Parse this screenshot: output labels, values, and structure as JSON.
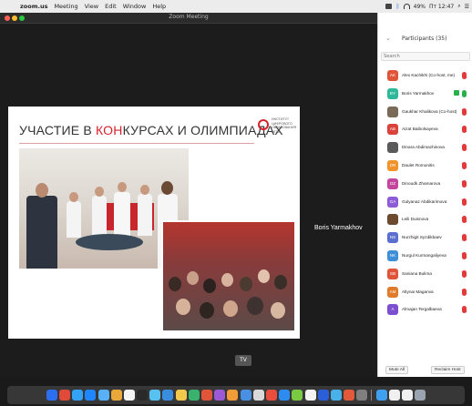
{
  "menubar": {
    "app_name": "zoom.us",
    "items": [
      "Meeting",
      "View",
      "Edit",
      "Window",
      "Help"
    ],
    "battery": "49%",
    "clock": "Пт 12:47"
  },
  "window": {
    "title": "Zoom Meeting"
  },
  "slide": {
    "title_prefix": "УЧАСТИЕ В ",
    "title_accent": "КОН",
    "title_rest": "КУРСАХ И ОЛИМПИАДАХ",
    "logo_text": "ИНСТИТУТ\nЦИФРОВОГО\nОБРАЗОВАНИЯ\nМГПУ"
  },
  "speaker": {
    "name": "Boris Yarmakhov"
  },
  "tv_badge": "TV",
  "participants_panel": {
    "title": "Participants (35)",
    "search_placeholder": "Search",
    "participants": [
      {
        "initials": "AK",
        "name": "Alex Kachikhi (Co-host, me)",
        "color": "#e0553a",
        "mic": "muted",
        "video": false
      },
      {
        "initials": "BY",
        "name": "Boris Yarmakhov",
        "color": "#2fb89a",
        "mic": "on",
        "video": true
      },
      {
        "initials": "",
        "name": "Gaukhar Khalikova (Co-host)",
        "color": "#7a6a58",
        "mic": "muted",
        "video": false
      },
      {
        "initials": "AB",
        "name": "Aizat Baibolsayeva",
        "color": "#d9433b",
        "mic": "muted",
        "video": false
      },
      {
        "initials": "",
        "name": "Dinara Abdimazhinova",
        "color": "#5a5a5a",
        "mic": "muted",
        "video": false
      },
      {
        "initials": "DR",
        "name": "Daulet Romonitis",
        "color": "#f0932b",
        "mic": "muted",
        "video": false
      },
      {
        "initials": "DZ",
        "name": "Dinoudk Zhamarova",
        "color": "#c4459e",
        "mic": "muted",
        "video": false
      },
      {
        "initials": "GA",
        "name": "Gulyanaz Abdikarimova",
        "color": "#8e5bd6",
        "mic": "muted",
        "video": false
      },
      {
        "initials": "",
        "name": "Leili Duisnova",
        "color": "#6b4a2e",
        "mic": "muted",
        "video": false
      },
      {
        "initials": "NS",
        "name": "Nurzhigit Syzdikbaev",
        "color": "#5a6fcf",
        "mic": "muted",
        "video": false
      },
      {
        "initials": "NK",
        "name": "Nurgul Kurmangaliyeva",
        "color": "#3f8fd8",
        "mic": "muted",
        "video": false
      },
      {
        "initials": "SB",
        "name": "Saniana Bulima",
        "color": "#e0553a",
        "mic": "muted",
        "video": false
      },
      {
        "initials": "AM",
        "name": "Altynai Maganva",
        "color": "#e07b2b",
        "mic": "muted",
        "video": false
      },
      {
        "initials": "A",
        "name": "Almajan Tergalbaeva",
        "color": "#7b4fd0",
        "mic": "muted",
        "video": false
      }
    ],
    "mute_all_label": "Mute All",
    "reclaim_host_label": "Reclaim Host"
  },
  "dock": {
    "icon_colors": [
      "#2b6ef2",
      "#e04a3a",
      "#34a2f5",
      "#1f86ff",
      "#5ab0f7",
      "#e8a83a",
      "#f4f4f4",
      "#2a2a2a",
      "#58c1f2",
      "#3a8dde",
      "#f2c94c",
      "#38b26d",
      "#e0553a",
      "#9b59d6",
      "#f29b38",
      "#4a90e2",
      "#d9d9d9",
      "#e84d3d",
      "#2d8cf0",
      "#7ac943",
      "#f2f2f2",
      "#2b5fd9",
      "#4ab0e8",
      "#e25a3a",
      "#7f7f7f",
      "#3fa0f0",
      "#f0f0f0",
      "#f0f0f0",
      "#9aa4b0"
    ]
  }
}
